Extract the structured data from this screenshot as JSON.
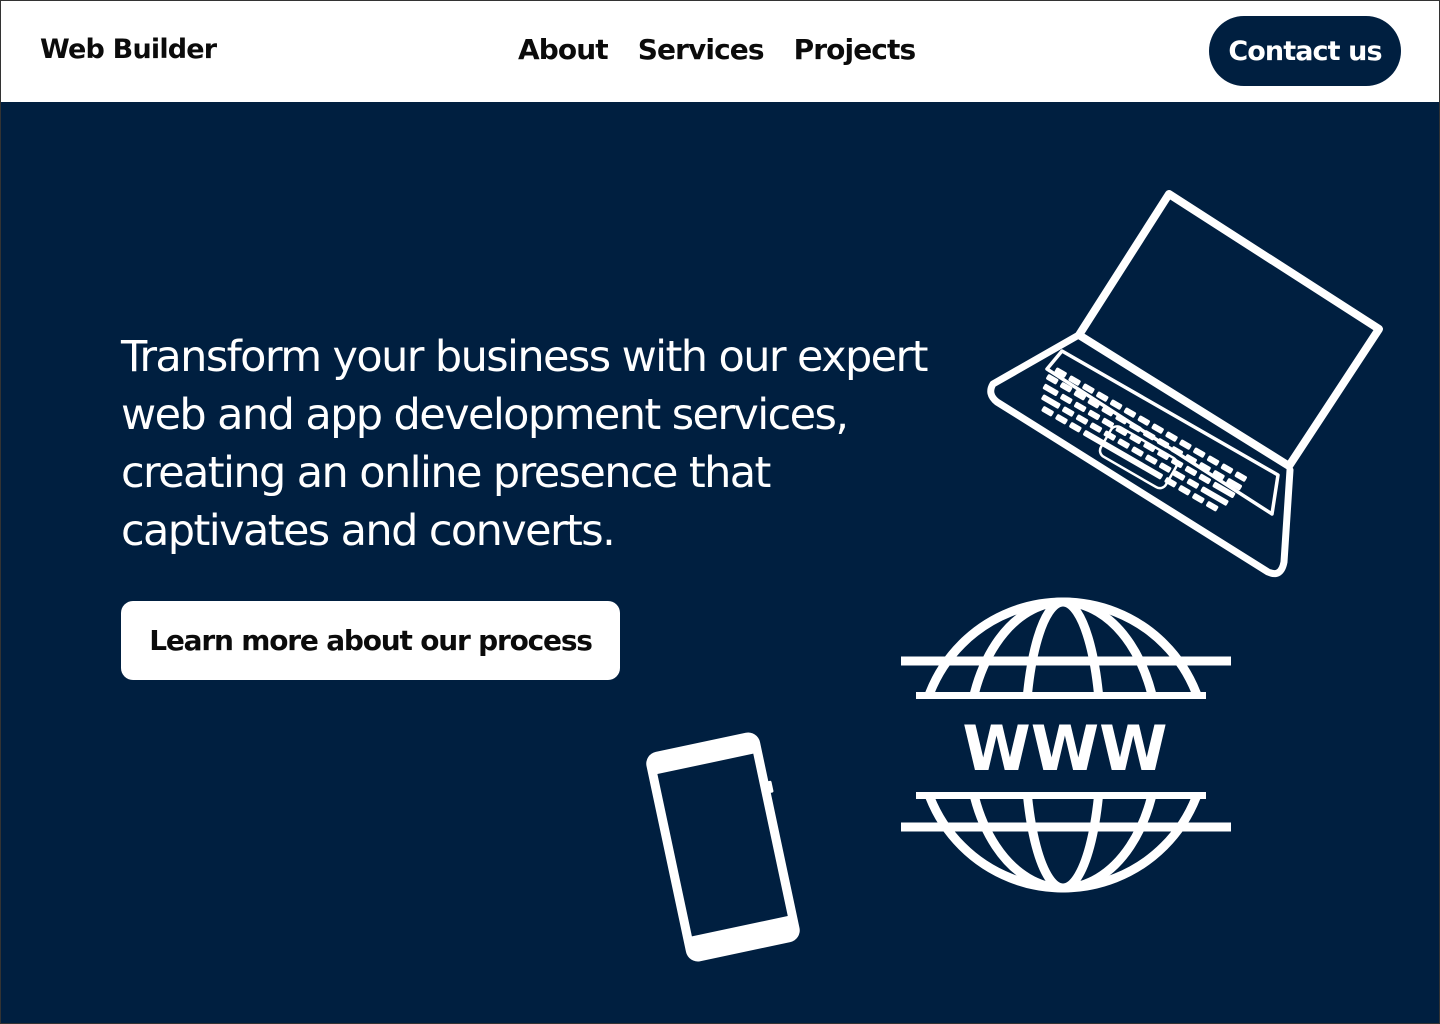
{
  "nav": {
    "brand": "Web Builder",
    "links": [
      "About",
      "Services",
      "Projects"
    ],
    "cta_label": "Contact us"
  },
  "hero": {
    "headline": "Transform your business with our expert web and app development services, creating an online presence that captivates and converts.",
    "button_label": "Learn more about our process",
    "globe_text": "WWW"
  },
  "colors": {
    "primary_navy": "#001f40",
    "white": "#ffffff",
    "text_dark": "#0b0b0b"
  },
  "icons": [
    "laptop-icon",
    "globe-www-icon",
    "smartphone-icon"
  ]
}
